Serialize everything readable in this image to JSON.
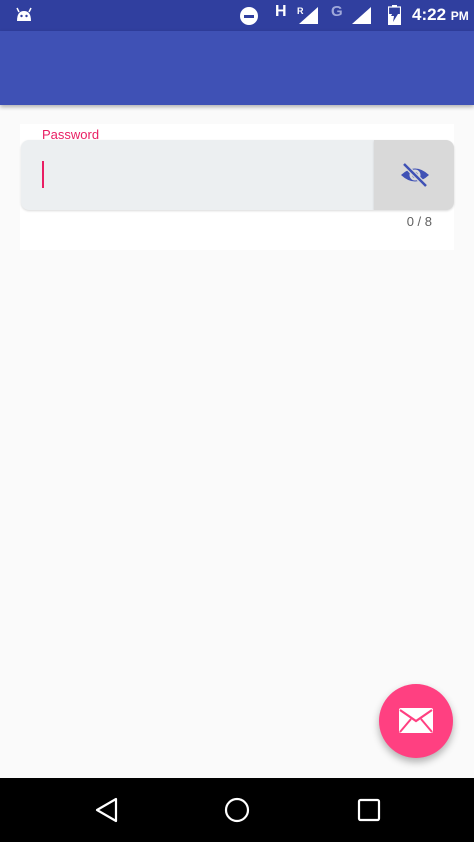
{
  "status_bar": {
    "network_h": "H",
    "network_r": "R",
    "network_g": "G",
    "time": "4:22",
    "time_suffix": "PM"
  },
  "password_field": {
    "label": "Password",
    "value": "",
    "counter": "0 / 8",
    "max_length": 8
  },
  "icons": {
    "toggle": "visibility-off-icon",
    "fab": "email-icon",
    "nav": [
      "back-icon",
      "home-icon",
      "recents-icon"
    ]
  },
  "colors": {
    "primary": "#3f51b5",
    "primary_dark": "#303f9f",
    "accent": "#ff4081",
    "label": "#e91e63"
  }
}
